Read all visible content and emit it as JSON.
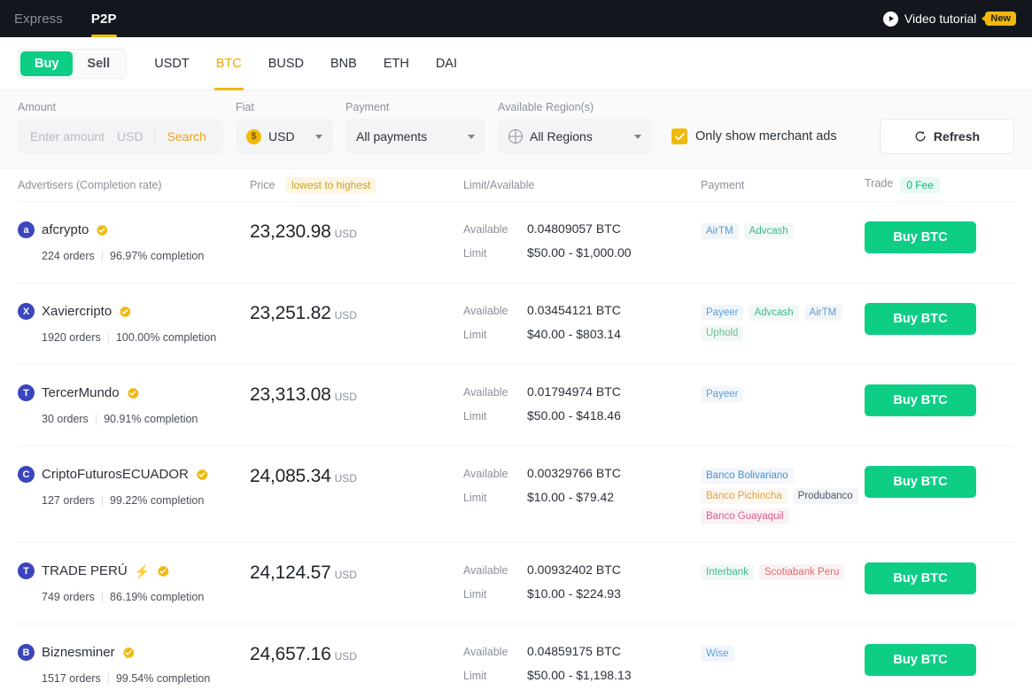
{
  "topbar": {
    "nav": [
      {
        "label": "Express",
        "active": false
      },
      {
        "label": "P2P",
        "active": true
      }
    ],
    "video_tutorial": "Video tutorial",
    "new_badge": "New",
    "play_icon": "play-circle-icon"
  },
  "coinbar": {
    "buy_label": "Buy",
    "sell_label": "Sell",
    "active_side": "Buy",
    "coins": [
      {
        "label": "USDT",
        "active": false
      },
      {
        "label": "BTC",
        "active": true
      },
      {
        "label": "BUSD",
        "active": false
      },
      {
        "label": "BNB",
        "active": false
      },
      {
        "label": "ETH",
        "active": false
      },
      {
        "label": "DAI",
        "active": false
      }
    ]
  },
  "filters": {
    "amount_label": "Amount",
    "amount_placeholder": "Enter amount",
    "amount_value": "",
    "amount_currency": "USD",
    "search_label": "Search",
    "fiat_label": "Fiat",
    "fiat_value": "USD",
    "fiat_coin_glyph": "$",
    "payment_label": "Payment",
    "payment_value": "All payments",
    "region_label": "Available Region(s)",
    "region_value": "All Regions",
    "merchant_checkbox_label": "Only show merchant ads",
    "merchant_checked": true,
    "refresh_label": "Refresh",
    "refresh_icon": "refresh-icon"
  },
  "table": {
    "headers": {
      "advertisers": "Advertisers (Completion rate)",
      "price": "Price",
      "price_sort_badge": "lowest to highest",
      "limit_available": "Limit/Available",
      "payment": "Payment",
      "trade": "Trade",
      "fee_badge": "0 Fee"
    },
    "labels": {
      "available": "Available",
      "limit": "Limit",
      "orders_suffix": "orders",
      "completion_suffix": "completion"
    },
    "buy_button_label": "Buy BTC",
    "rows": [
      {
        "avatar_letter": "a",
        "avatar_color": "#3b45bc",
        "name": "afcrypto",
        "verified": true,
        "bolt": false,
        "orders": "224 orders",
        "completion": "96.97% completion",
        "price": "23,230.98",
        "price_currency": "USD",
        "available": "0.04809057 BTC",
        "limit": "$50.00 - $1,000.00",
        "payments": [
          {
            "label": "AirTM",
            "color": "#5c9ad4",
            "bg": "#f2f5f8"
          },
          {
            "label": "Advcash",
            "color": "#3fb98a",
            "bg": "#f1f8f5"
          }
        ]
      },
      {
        "avatar_letter": "X",
        "avatar_color": "#3b45bc",
        "name": "Xaviercripto",
        "verified": true,
        "bolt": false,
        "orders": "1920 orders",
        "completion": "100.00% completion",
        "price": "23,251.82",
        "price_currency": "USD",
        "available": "0.03454121 BTC",
        "limit": "$40.00 - $803.14",
        "payments": [
          {
            "label": "Payeer",
            "color": "#5aa0dd",
            "bg": "#f2f6fa"
          },
          {
            "label": "Advcash",
            "color": "#3fb98a",
            "bg": "#f1f8f5"
          },
          {
            "label": "AirTM",
            "color": "#5c9ad4",
            "bg": "#f2f5f8"
          },
          {
            "label": "Uphold",
            "color": "#6bbf93",
            "bg": "#f2f8f5"
          }
        ]
      },
      {
        "avatar_letter": "T",
        "avatar_color": "#3b45bc",
        "name": "TercerMundo",
        "verified": true,
        "bolt": false,
        "orders": "30 orders",
        "completion": "90.91% completion",
        "price": "23,313.08",
        "price_currency": "USD",
        "available": "0.01794974 BTC",
        "limit": "$50.00 - $418.46",
        "payments": [
          {
            "label": "Payeer",
            "color": "#5aa0dd",
            "bg": "#f2f6fa"
          }
        ]
      },
      {
        "avatar_letter": "C",
        "avatar_color": "#3b45bc",
        "name": "CriptoFuturosECUADOR",
        "verified": true,
        "bolt": false,
        "orders": "127 orders",
        "completion": "99.22% completion",
        "price": "24,085.34",
        "price_currency": "USD",
        "available": "0.00329766 BTC",
        "limit": "$10.00 - $79.42",
        "payments": [
          {
            "label": "Banco Bolivariano",
            "color": "#4a8fd0",
            "bg": "#f3f6fa"
          },
          {
            "label": "Banco Pichincha",
            "color": "#e0a040",
            "bg": "#fbf7f1"
          },
          {
            "label": "Produbanco",
            "color": "#4a5568",
            "bg": "#f4f5f7"
          },
          {
            "label": "Banco Guayaquil",
            "color": "#d95b8f",
            "bg": "#fbf2f6"
          }
        ]
      },
      {
        "avatar_letter": "T",
        "avatar_color": "#3b45bc",
        "name": "TRADE PERÚ",
        "verified": true,
        "bolt": true,
        "orders": "749 orders",
        "completion": "86.19% completion",
        "price": "24,124.57",
        "price_currency": "USD",
        "available": "0.00932402 BTC",
        "limit": "$10.00 - $224.93",
        "payments": [
          {
            "label": "Interbank",
            "color": "#3fb98a",
            "bg": "#f1f8f5"
          },
          {
            "label": "Scotiabank Peru",
            "color": "#e06a6a",
            "bg": "#fbf3f3"
          }
        ]
      },
      {
        "avatar_letter": "B",
        "avatar_color": "#3b45bc",
        "name": "Biznesminer",
        "verified": true,
        "bolt": false,
        "orders": "1517 orders",
        "completion": "99.54% completion",
        "price": "24,657.16",
        "price_currency": "USD",
        "available": "0.04859175 BTC",
        "limit": "$50.00 - $1,198.13",
        "payments": [
          {
            "label": "Wise",
            "color": "#5aa0dd",
            "bg": "#f2f6fa"
          }
        ]
      }
    ]
  },
  "colors": {
    "accent_green": "#0ece86",
    "accent_yellow": "#f0b90b",
    "dark_header": "#13161c"
  }
}
